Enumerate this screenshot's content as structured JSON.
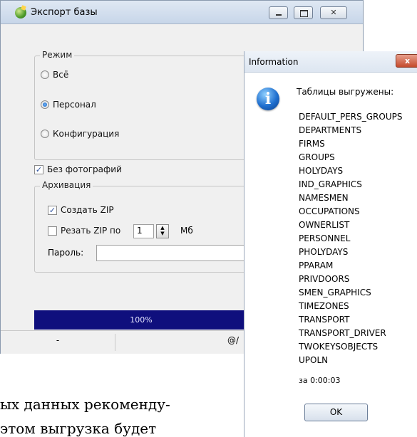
{
  "main_window": {
    "title": "Экспорт базы",
    "controls": {
      "minimize": "▁",
      "maximize": "▢",
      "close": "✕"
    },
    "mode_group": {
      "label": "Режим",
      "options": [
        {
          "label": "Всё",
          "selected": false
        },
        {
          "label": "Персонал",
          "selected": true
        },
        {
          "label": "Конфигурация",
          "selected": false
        }
      ]
    },
    "no_photos": {
      "label": "Без фотографий",
      "checked": true
    },
    "archive_group": {
      "label": "Архивация",
      "create_zip": {
        "label": "Создать ZIP",
        "checked": true
      },
      "split_zip": {
        "label": "Резать ZIP по",
        "checked": false,
        "value": "1",
        "unit": "Мб"
      },
      "password": {
        "label": "Пароль:",
        "value": ""
      }
    },
    "progress": {
      "value": 1.0,
      "label": "100%"
    },
    "statusbar": {
      "cell1": "-",
      "cell2": "@/"
    }
  },
  "dialog": {
    "title": "Information",
    "close_glyph": "x",
    "icon": "info-icon",
    "heading": "Таблицы выгружены:",
    "tables": [
      "DEFAULT_PERS_GROUPS",
      "DEPARTMENTS",
      "FIRMS",
      "GROUPS",
      "HOLYDAYS",
      "IND_GRAPHICS",
      "NAMESMEN",
      "OCCUPATIONS",
      "OWNERLIST",
      "PERSONNEL",
      "PHOLYDAYS",
      "PPARAM",
      "PRIVDOORS",
      "SMEN_GRAPHICS",
      "TIMEZONES",
      "TRANSPORT",
      "TRANSPORT_DRIVER",
      "TWOKEYSOBJECTS",
      "UPOLN"
    ],
    "duration": "за 0:00:03",
    "ok_label": "OK"
  },
  "document_text": {
    "line1": "ых данных рекоменду-",
    "line2": "этом выгрузка будет"
  }
}
